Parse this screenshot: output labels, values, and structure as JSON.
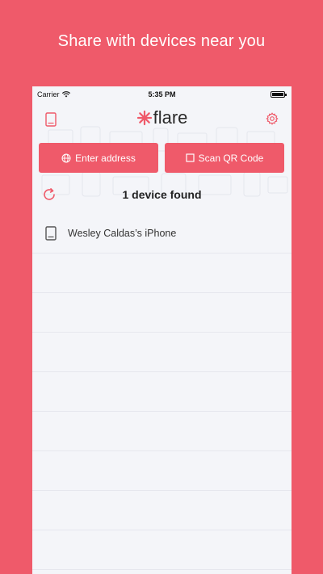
{
  "headline": "Share with devices near you",
  "status_bar": {
    "carrier": "Carrier",
    "time": "5:35 PM"
  },
  "nav": {
    "logo_text": "flare",
    "left_icon": "tablet-icon",
    "right_icon": "gear-icon"
  },
  "actions": {
    "enter_address_label": "Enter address",
    "enter_address_icon": "globe-icon",
    "scan_qr_label": "Scan QR Code",
    "scan_qr_icon": "square-icon"
  },
  "devices_found_text": "1 device found",
  "devices": [
    {
      "name": "Wesley Caldas’s iPhone",
      "icon": "tablet-icon"
    }
  ],
  "colors": {
    "accent": "#ef5a6a",
    "panel_bg": "#f4f5f9",
    "divider": "#e6e7ee",
    "text_dark": "#222222"
  }
}
